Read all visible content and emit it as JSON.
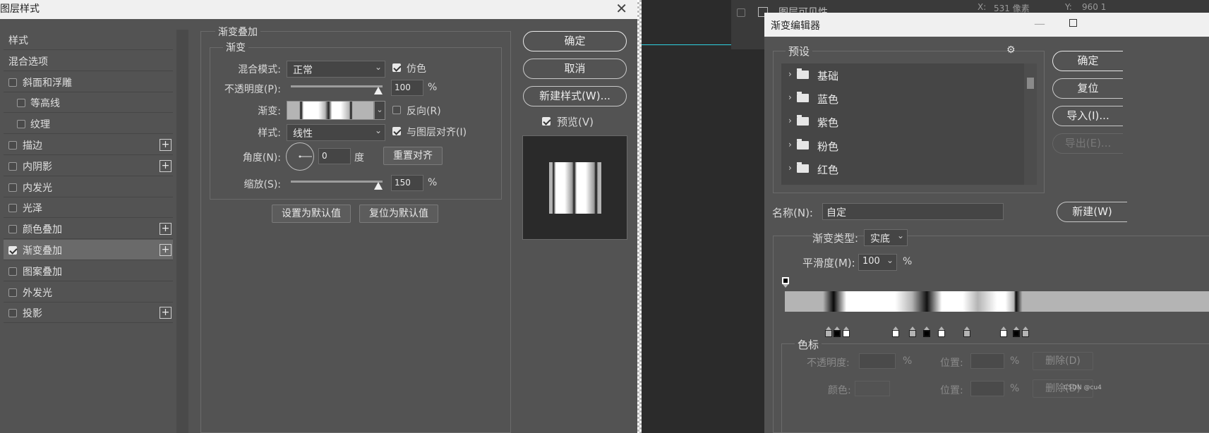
{
  "layer_style": {
    "title": "图层样式",
    "close": "✕",
    "list": [
      {
        "label": "样式",
        "checkbox": false,
        "checked": false,
        "plus": false,
        "indent": false
      },
      {
        "label": "混合选项",
        "checkbox": false,
        "checked": false,
        "plus": false,
        "indent": false
      },
      {
        "label": "斜面和浮雕",
        "checkbox": true,
        "checked": false,
        "plus": false,
        "indent": false
      },
      {
        "label": "等高线",
        "checkbox": true,
        "checked": false,
        "plus": false,
        "indent": true
      },
      {
        "label": "纹理",
        "checkbox": true,
        "checked": false,
        "plus": false,
        "indent": true
      },
      {
        "label": "描边",
        "checkbox": true,
        "checked": false,
        "plus": true,
        "indent": false
      },
      {
        "label": "内阴影",
        "checkbox": true,
        "checked": false,
        "plus": true,
        "indent": false
      },
      {
        "label": "内发光",
        "checkbox": true,
        "checked": false,
        "plus": false,
        "indent": false
      },
      {
        "label": "光泽",
        "checkbox": true,
        "checked": false,
        "plus": false,
        "indent": false
      },
      {
        "label": "颜色叠加",
        "checkbox": true,
        "checked": false,
        "plus": true,
        "indent": false
      },
      {
        "label": "渐变叠加",
        "checkbox": true,
        "checked": true,
        "plus": true,
        "indent": false,
        "selected": true
      },
      {
        "label": "图案叠加",
        "checkbox": true,
        "checked": false,
        "plus": false,
        "indent": false
      },
      {
        "label": "外发光",
        "checkbox": true,
        "checked": false,
        "plus": false,
        "indent": false
      },
      {
        "label": "投影",
        "checkbox": true,
        "checked": false,
        "plus": true,
        "indent": false
      }
    ],
    "plus_glyph": "+",
    "panel": {
      "group_title": "渐变叠加",
      "sub_title": "渐变",
      "blend_mode_label": "混合模式:",
      "blend_mode_value": "正常",
      "dither_label": "仿色",
      "dither_checked": true,
      "opacity_label": "不透明度(P):",
      "opacity_value": "100",
      "opacity_pct": 1.0,
      "pct": "%",
      "gradient_label": "渐变:",
      "reverse_label": "反向(R)",
      "reverse_checked": false,
      "style_label": "样式:",
      "style_value": "线性",
      "align_label": "与图层对齐(I)",
      "align_checked": true,
      "angle_label": "角度(N):",
      "angle_value": "0",
      "degree_unit": "度",
      "reset_align_label": "重置对齐",
      "scale_label": "缩放(S):",
      "scale_value": "150",
      "scale_pct": 1.0,
      "set_default_label": "设置为默认值",
      "reset_default_label": "复位为默认值"
    },
    "buttons": {
      "ok": "确定",
      "cancel": "取消",
      "new_style": "新建样式(W)...",
      "preview_label": "预览(V)",
      "preview_checked": true
    }
  },
  "background": {
    "panel_text": "图层可见性",
    "x_label": "X:",
    "x_value": "531 像素",
    "y_label": "Y:",
    "y_value": "960 1"
  },
  "gradient_editor": {
    "title": "渐变编辑器",
    "presets_label": "预设",
    "gear": "⚙",
    "presets": [
      "基础",
      "蓝色",
      "紫色",
      "粉色",
      "红色"
    ],
    "buttons": {
      "ok": "确定",
      "reset": "复位",
      "import": "导入(I)...",
      "export": "导出(E)...",
      "new": "新建(W)"
    },
    "name_label": "名称(N):",
    "name_value": "自定",
    "type_label": "渐变类型:",
    "type_value": "实底",
    "smooth_label": "平滑度(M):",
    "smooth_value": "100",
    "pct": "%",
    "stops_group_label": "色标",
    "opacity_label": "不透明度:",
    "position_label": "位置:",
    "delete_label": "删除(D)",
    "color_label": "颜色:",
    "watermark": "CSDN @cu4"
  }
}
